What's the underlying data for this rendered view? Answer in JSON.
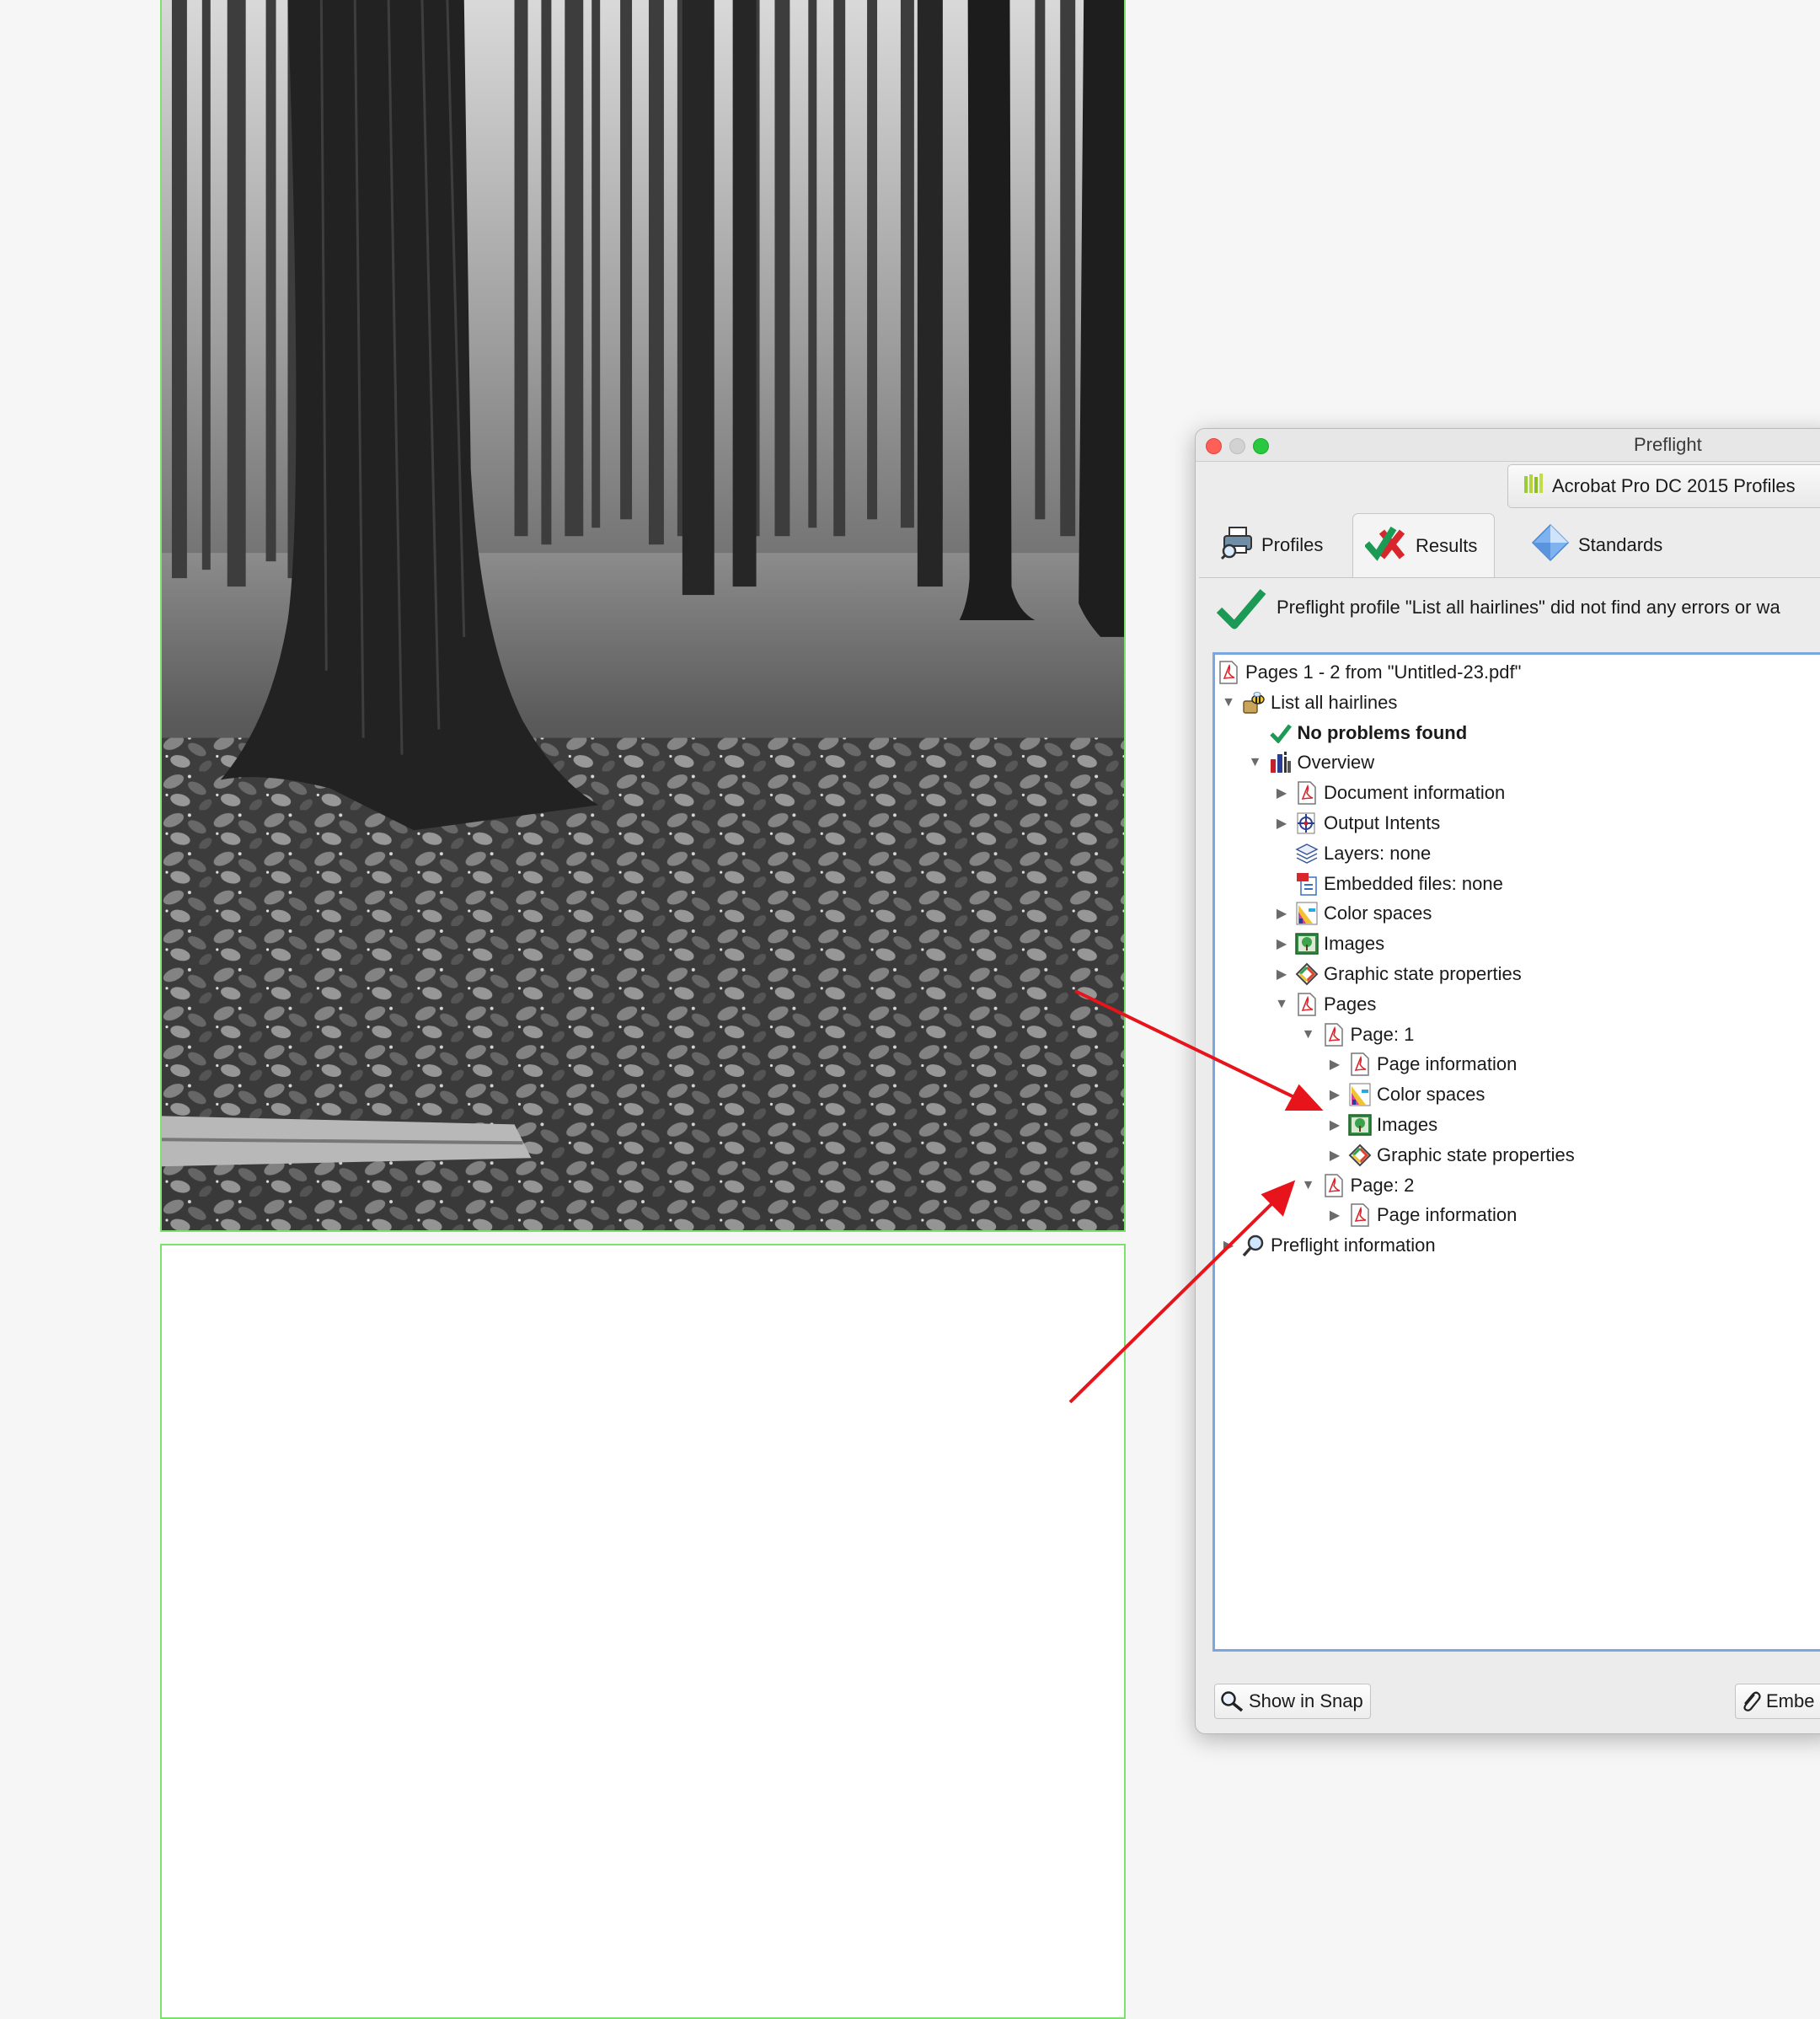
{
  "window": {
    "title": "Preflight"
  },
  "profiles_button": {
    "label": "Acrobat Pro DC 2015 Profiles"
  },
  "tabs": [
    {
      "label": "Profiles"
    },
    {
      "label": "Results",
      "selected": true
    },
    {
      "label": "Standards"
    }
  ],
  "result_message": "Preflight profile \"List all hairlines\" did not find any errors or wa",
  "tree": [
    {
      "label": "Pages 1 - 2 from \"Untitled-23.pdf\"",
      "icon": "pdf-icon",
      "depth": 0,
      "toggle": "none"
    },
    {
      "label": "List all hairlines",
      "icon": "profile-bee-icon",
      "depth": 1,
      "toggle": "expanded"
    },
    {
      "label": "No problems found",
      "icon": "checkmark-icon",
      "depth": 2,
      "toggle": "none",
      "bold": true
    },
    {
      "label": "Overview",
      "icon": "overview-icon",
      "depth": 2,
      "toggle": "expanded"
    },
    {
      "label": "Document information",
      "icon": "pdf-icon",
      "depth": 3,
      "toggle": "collapsed"
    },
    {
      "label": "Output Intents",
      "icon": "output-intents-icon",
      "depth": 3,
      "toggle": "collapsed"
    },
    {
      "label": "Layers: none",
      "icon": "layers-icon",
      "depth": 3,
      "toggle": "none"
    },
    {
      "label": "Embedded files: none",
      "icon": "embedded-files-icon",
      "depth": 3,
      "toggle": "none"
    },
    {
      "label": "Color spaces",
      "icon": "color-spaces-icon",
      "depth": 3,
      "toggle": "collapsed"
    },
    {
      "label": "Images",
      "icon": "images-icon",
      "depth": 3,
      "toggle": "collapsed"
    },
    {
      "label": "Graphic state properties",
      "icon": "graphic-state-icon",
      "depth": 3,
      "toggle": "collapsed"
    },
    {
      "label": "Pages",
      "icon": "pdf-icon",
      "depth": 3,
      "toggle": "expanded"
    },
    {
      "label": "Page: 1",
      "icon": "pdf-icon",
      "depth": 4,
      "toggle": "expanded"
    },
    {
      "label": "Page information",
      "icon": "pdf-icon",
      "depth": 5,
      "toggle": "collapsed"
    },
    {
      "label": "Color spaces",
      "icon": "color-spaces-icon",
      "depth": 5,
      "toggle": "collapsed"
    },
    {
      "label": "Images",
      "icon": "images-icon",
      "depth": 5,
      "toggle": "collapsed"
    },
    {
      "label": "Graphic state properties",
      "icon": "graphic-state-icon",
      "depth": 5,
      "toggle": "collapsed"
    },
    {
      "label": "Page: 2",
      "icon": "pdf-icon",
      "depth": 4,
      "toggle": "expanded"
    },
    {
      "label": "Page information",
      "icon": "pdf-icon",
      "depth": 5,
      "toggle": "collapsed"
    },
    {
      "label": "Preflight information",
      "icon": "magnifier-icon",
      "depth": 1,
      "toggle": "collapsed"
    }
  ],
  "footer": {
    "snap_button": "Show in Snap",
    "embed_button": "Embe"
  },
  "colors": {
    "page_border": "#7be36c",
    "annotation_arrow": "#e8141b",
    "tree_focus_border": "#7aa7e0",
    "success_check": "#1a9a55"
  }
}
